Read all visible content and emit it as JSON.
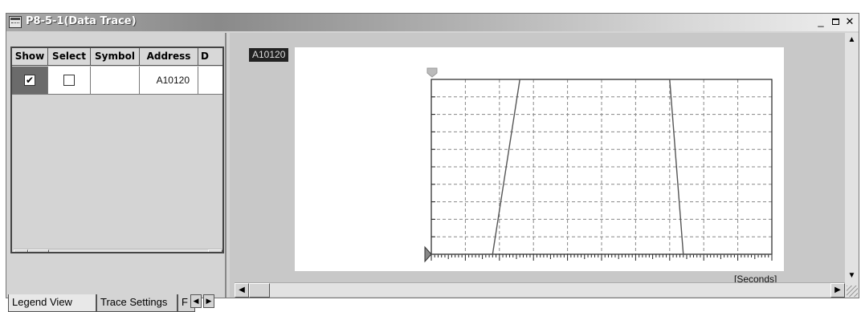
{
  "window": {
    "title": "P8-5-1(Data Trace)",
    "minimize_label": "_",
    "close_label": "✕"
  },
  "legend_table": {
    "columns": [
      "Show",
      "Select",
      "Symbol",
      "Address",
      "D"
    ],
    "rows": [
      {
        "show": "✔",
        "select": "",
        "symbol": "",
        "address": "A10120"
      }
    ]
  },
  "scroll": {
    "left_arrow": "◀",
    "right_arrow": "▶",
    "up_arrow": "▲",
    "down_arrow": "▼"
  },
  "tabs": [
    "Legend View",
    "Trace Settings",
    "F"
  ],
  "trace": {
    "label": "A10120",
    "x_unit": "[Seconds]"
  },
  "chart_data": {
    "type": "line",
    "title": "",
    "xlabel": "[Seconds]",
    "ylabel": "",
    "series": [
      {
        "name": "A10120",
        "x": [
          0,
          18,
          26,
          70,
          74,
          100
        ],
        "y": [
          0,
          0,
          100,
          100,
          0,
          0
        ]
      }
    ],
    "xlim": [
      0,
      100
    ],
    "ylim": [
      0,
      100
    ],
    "grid": true,
    "legend": "none"
  },
  "colors": {
    "trace_line": "#555555",
    "grid_line": "#888888",
    "label_bg": "#222222"
  }
}
